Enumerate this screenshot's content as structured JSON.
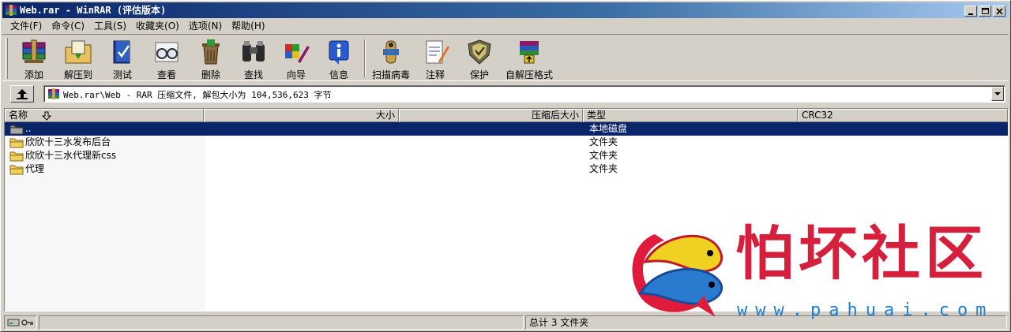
{
  "window": {
    "title": "Web.rar - WinRAR (评估版本)"
  },
  "menu": [
    "文件(F)",
    "命令(C)",
    "工具(S)",
    "收藏夹(O)",
    "选项(N)",
    "帮助(H)"
  ],
  "toolbar": {
    "add": "添加",
    "extract": "解压到",
    "test": "测试",
    "view": "查看",
    "delete": "删除",
    "find": "查找",
    "wizard": "向导",
    "info": "信息",
    "virusscan": "扫描病毒",
    "comment": "注释",
    "protect": "保护",
    "sfx": "自解压格式"
  },
  "address": {
    "text": "Web.rar\\Web - RAR 压缩文件, 解包大小为 104,536,623 字节"
  },
  "columns": {
    "name": "名称",
    "size": "大小",
    "packed": "压缩后大小",
    "type": "类型",
    "crc": "CRC32"
  },
  "files": [
    {
      "name": "..",
      "type": "本地磁盘"
    },
    {
      "name": "欣欣十三水发布后台",
      "type": "文件夹"
    },
    {
      "name": "欣欣十三水代理新css",
      "type": "文件夹"
    },
    {
      "name": "代理",
      "type": "文件夹"
    }
  ],
  "status": {
    "summary": "总计 3 文件夹"
  },
  "watermark": {
    "text": "怕坏社区",
    "url": "www.pahuai.com"
  },
  "colors": {
    "title_bar": "#0a246a",
    "selection": "#0a246a",
    "watermark_red": "#d61f3c",
    "watermark_blue": "#1e7fd6"
  }
}
